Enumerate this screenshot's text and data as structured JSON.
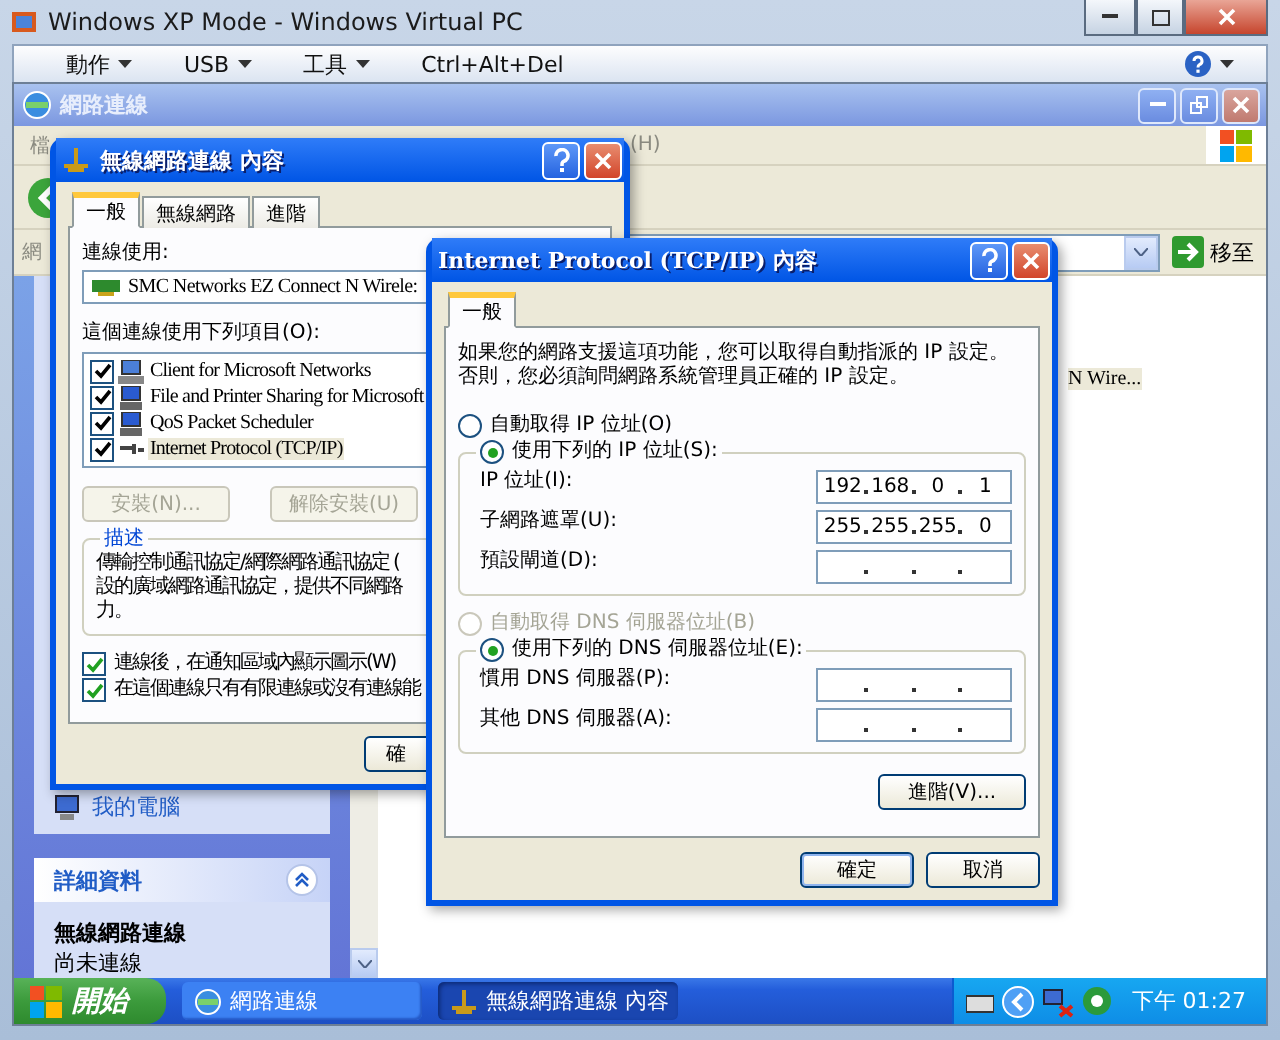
{
  "host": {
    "title": "Windows XP Mode - Windows Virtual PC",
    "menus": [
      {
        "label": "動作"
      },
      {
        "label": "USB"
      },
      {
        "label": "工具"
      }
    ],
    "ctrl_alt_del": "Ctrl+Alt+Del"
  },
  "explorer": {
    "title": "網路連線",
    "menu_left": "檔",
    "menu_right": "(H)",
    "address_label": "網",
    "go_button": "移至",
    "item_label": "N Wire...",
    "sidebar": {
      "link": "我的電腦",
      "details_title": "詳細資料",
      "details_name": "無線網路連線",
      "details_status": "尚未連線"
    }
  },
  "dialog1": {
    "title": "無線網路連線 內容",
    "tabs": [
      {
        "label": "一般",
        "selected": true
      },
      {
        "label": "無線網路",
        "selected": false
      },
      {
        "label": "進階",
        "selected": false
      }
    ],
    "connect_using_label": "連線使用:",
    "adapter": "SMC Networks EZ Connect N Wirele:",
    "items_label": "這個連線使用下列項目(O):",
    "items": [
      {
        "label": "Client for Microsoft Networks",
        "checked": true,
        "selected": false,
        "kind": "client"
      },
      {
        "label": "File and Printer Sharing for Microsoft",
        "checked": true,
        "selected": false,
        "kind": "service"
      },
      {
        "label": "QoS Packet Scheduler",
        "checked": true,
        "selected": false,
        "kind": "service"
      },
      {
        "label": "Internet Protocol (TCP/IP)",
        "checked": true,
        "selected": true,
        "kind": "protocol"
      }
    ],
    "buttons": [
      {
        "label": "安裝(N)...",
        "disabled": true
      },
      {
        "label": "解除安裝(U)",
        "disabled": true
      }
    ],
    "description": {
      "title": "描述",
      "lines": [
        "傳輸控制通訊協定/網際網路通訊協定 (",
        "設的廣域網路通訊協定，提供不同網路",
        "力。"
      ]
    },
    "options": [
      {
        "label": "連線後，在通知區域內顯示圖示(W)",
        "checked": true
      },
      {
        "label": "在這個連線只有有限連線或沒有連線能",
        "checked": true
      }
    ],
    "ok_button": "確"
  },
  "dialog2": {
    "title": "Internet Protocol (TCP/IP) 內容",
    "tabs": [
      {
        "label": "一般",
        "selected": true
      }
    ],
    "intro": "如果您的網路支援這項功能，您可以取得自動指派的 IP 設定。否則，您必須詢問網路系統管理員正確的 IP 設定。",
    "ip_mode": [
      {
        "label": "自動取得 IP 位址(O)",
        "selected": false,
        "disabled": false
      },
      {
        "label": "使用下列的 IP 位址(S):",
        "selected": true,
        "disabled": false
      }
    ],
    "ip_fields": [
      {
        "label": "IP 位址(I):",
        "octets": [
          "192",
          "168",
          "0",
          "1"
        ]
      },
      {
        "label": "子網路遮罩(U):",
        "octets": [
          "255",
          "255",
          "255",
          "0"
        ]
      },
      {
        "label": "預設閘道(D):"
      }
    ],
    "dns_mode": [
      {
        "label": "自動取得 DNS 伺服器位址(B)",
        "selected": false,
        "disabled": true
      },
      {
        "label": "使用下列的 DNS 伺服器位址(E):",
        "selected": true,
        "disabled": false
      }
    ],
    "dns_fields": [
      {
        "label": "慣用 DNS 伺服器(P):"
      },
      {
        "label": "其他 DNS 伺服器(A):"
      }
    ],
    "advanced_button": "進階(V)...",
    "ok_button": "確定",
    "cancel_button": "取消"
  },
  "taskbar": {
    "start": "開始",
    "buttons": [
      {
        "label": "網路連線",
        "selected": false,
        "kind": "network"
      },
      {
        "label": "無線網路連線 內容",
        "selected": true,
        "kind": "dialog"
      }
    ],
    "clock": "下午 01:27"
  }
}
